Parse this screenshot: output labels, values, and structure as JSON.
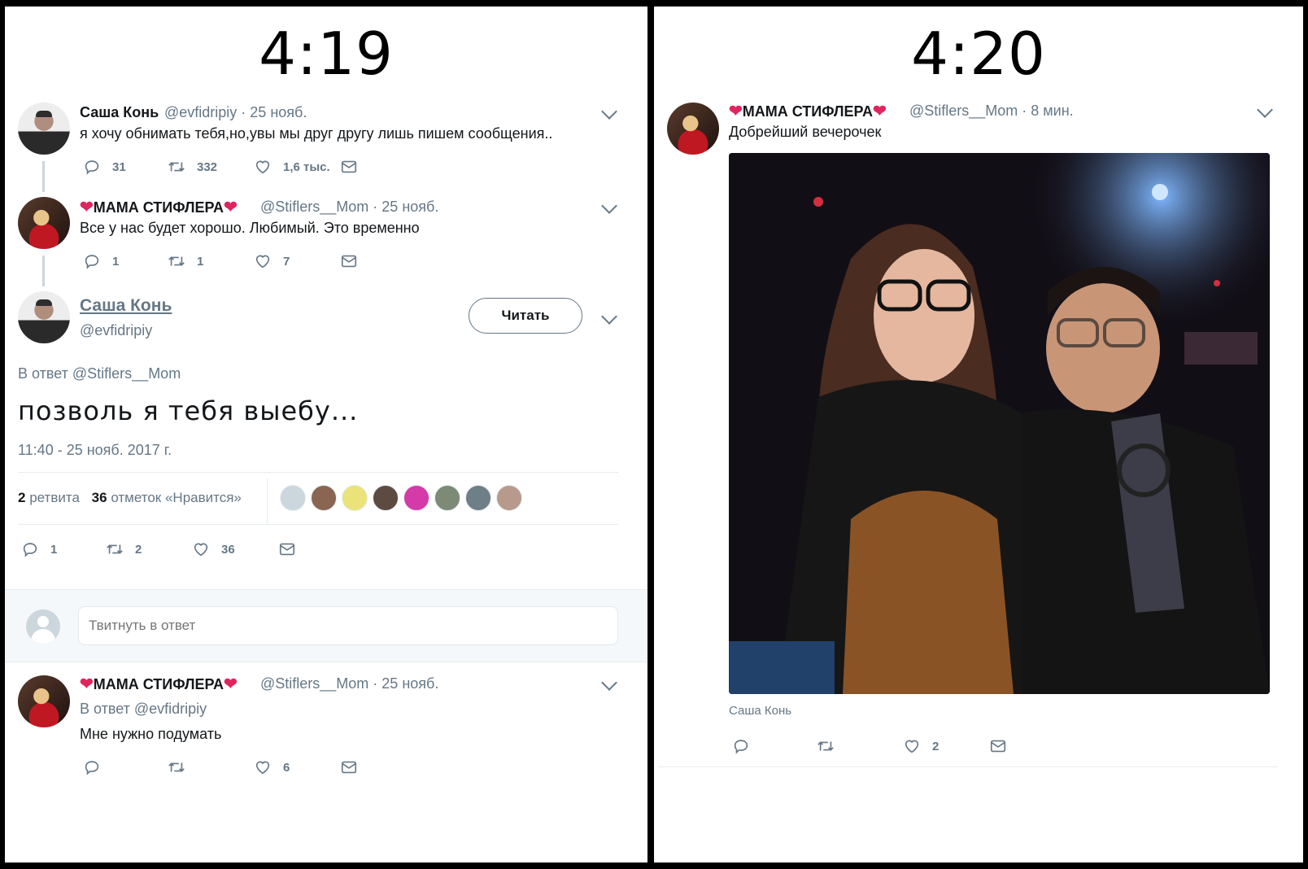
{
  "left": {
    "time": "4:19",
    "tweet1": {
      "name": "Саша Конь",
      "meta": "@evfidripiy · 25 нояб.",
      "text": "я хочу обнимать тебя,но,увы мы друг другу лишь пишем сообщения..",
      "replies": "31",
      "retweets": "332",
      "likes": "1,6 тыс."
    },
    "tweet2": {
      "name": "МАМА СТИФЛЕРА",
      "meta": "@Stiflers__Mom · 25 нояб.",
      "text": "Все у нас будет хорошо. Любимый. Это временно",
      "replies": "1",
      "retweets": "1",
      "likes": "7"
    },
    "main": {
      "name": "Саша Конь",
      "handle": "@evfidripiy",
      "follow": "Читать",
      "reply_to": "В ответ @Stiflers__Mom",
      "text": "позволь я тебя выебу...",
      "timestamp": "11:40 - 25 нояб. 2017 г.",
      "retweet_count": "2",
      "retweet_label": "ретвита",
      "like_count": "36",
      "like_label": "отметок «Нравится»",
      "replies": "1",
      "retweets": "2",
      "likes": "36"
    },
    "reply_box": {
      "placeholder": "Твитнуть в ответ"
    },
    "tweet3": {
      "name": "МАМА СТИФЛЕРА",
      "meta": "@Stiflers__Mom · 25 нояб.",
      "reply_to": "В ответ @evfidripiy",
      "text": "Мне нужно подумать",
      "likes": "6"
    }
  },
  "right": {
    "time": "4:20",
    "tweet": {
      "name": "МАМА СТИФЛЕРА",
      "meta": "@Stiflers__Mom · 8 мин.",
      "text": "Добрейший вечерочек",
      "tag": "Саша Конь",
      "likes": "2"
    }
  },
  "colors": {
    "heart": "#e0245e",
    "secondary": "#657786",
    "border": "#e6ecf0"
  },
  "icons": [
    "reply-icon",
    "retweet-icon",
    "like-icon",
    "dm-icon",
    "chevron-down-icon",
    "heart-emoji-icon"
  ]
}
